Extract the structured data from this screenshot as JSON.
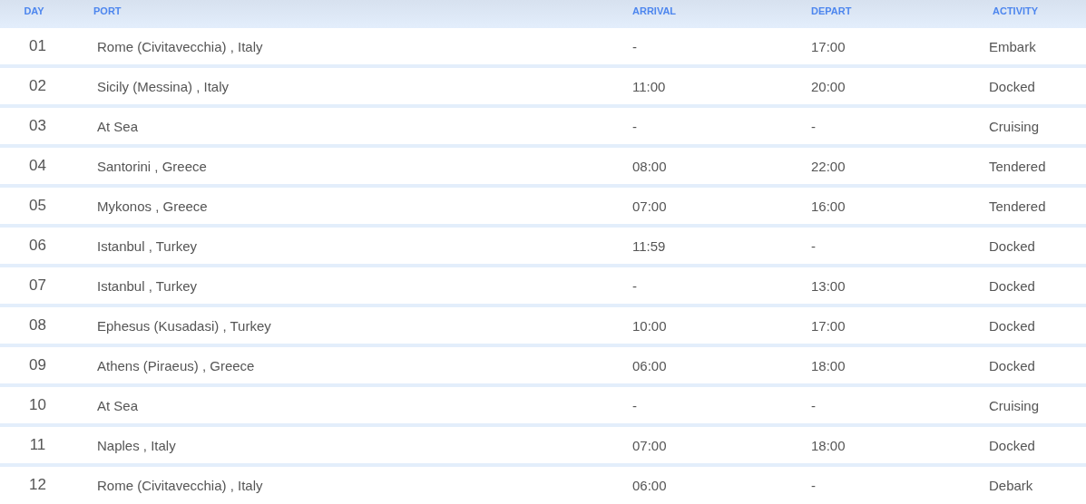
{
  "table": {
    "columns": [
      "DAY",
      "PORT",
      "ARRIVAL",
      "DEPART",
      "ACTIVITY"
    ],
    "rows": [
      {
        "day": "01",
        "port": "Rome (Civitavecchia) , Italy",
        "arrival": "-",
        "depart": "17:00",
        "activity": "Embark"
      },
      {
        "day": "02",
        "port": "Sicily (Messina) , Italy",
        "arrival": "11:00",
        "depart": "20:00",
        "activity": "Docked"
      },
      {
        "day": "03",
        "port": "At Sea",
        "arrival": "-",
        "depart": "-",
        "activity": "Cruising"
      },
      {
        "day": "04",
        "port": "Santorini , Greece",
        "arrival": "08:00",
        "depart": "22:00",
        "activity": "Tendered"
      },
      {
        "day": "05",
        "port": "Mykonos , Greece",
        "arrival": "07:00",
        "depart": "16:00",
        "activity": "Tendered"
      },
      {
        "day": "06",
        "port": "Istanbul , Turkey",
        "arrival": "11:59",
        "depart": "-",
        "activity": "Docked"
      },
      {
        "day": "07",
        "port": "Istanbul , Turkey",
        "arrival": "-",
        "depart": "13:00",
        "activity": "Docked"
      },
      {
        "day": "08",
        "port": "Ephesus (Kusadasi) , Turkey",
        "arrival": "10:00",
        "depart": "17:00",
        "activity": "Docked"
      },
      {
        "day": "09",
        "port": "Athens (Piraeus) , Greece",
        "arrival": "06:00",
        "depart": "18:00",
        "activity": "Docked"
      },
      {
        "day": "10",
        "port": "At Sea",
        "arrival": "-",
        "depart": "-",
        "activity": "Cruising"
      },
      {
        "day": "11",
        "port": "Naples , Italy",
        "arrival": "07:00",
        "depart": "18:00",
        "activity": "Docked"
      },
      {
        "day": "12",
        "port": "Rome (Civitavecchia) , Italy",
        "arrival": "06:00",
        "depart": "-",
        "activity": "Debark"
      }
    ]
  }
}
